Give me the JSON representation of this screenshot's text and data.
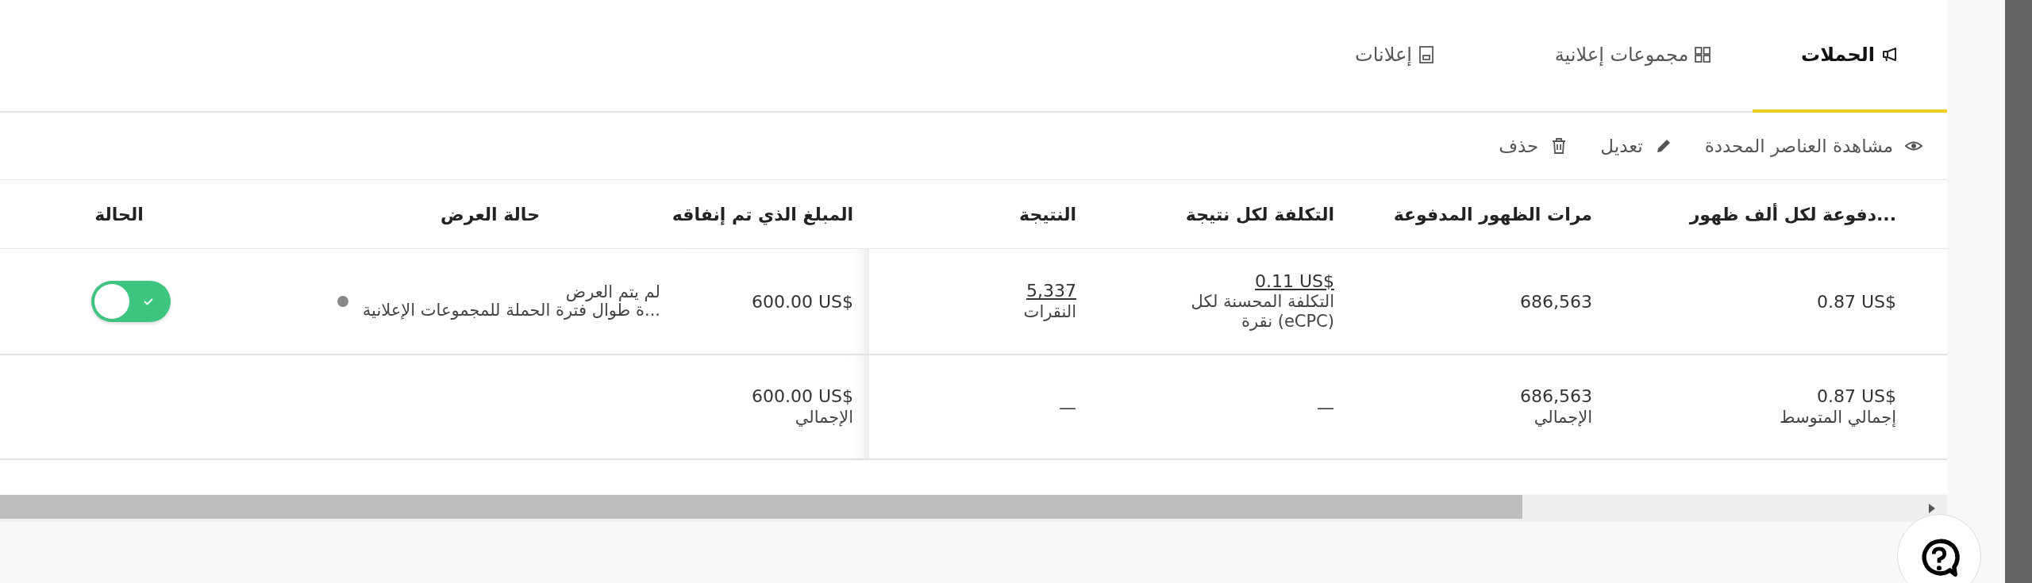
{
  "tabs": [
    {
      "label": "الحملات",
      "selected": true
    },
    {
      "label": "مجموعات إعلانية",
      "selected": false
    },
    {
      "label": "إعلانات",
      "selected": false
    }
  ],
  "actions": [
    "مشاهدة العناصر المحددة",
    "تعديل",
    "حذف"
  ],
  "table": {
    "columns": [
      "...دفوعة لكل ألف ظهور",
      "مرات الظهور المدفوعة",
      "التكلفة لكل نتيجة",
      "النتيجة",
      "المبلغ الذي تم إنفاقه",
      "حالة العرض",
      "الحالة"
    ],
    "rows": [
      {
        "cpm": "0.87 US$",
        "impressions": "686,563",
        "cost_per_result": {
          "value": "0.11 US$",
          "label": "التكلفة المحسنة لكل (eCPC) نقرة"
        },
        "result": {
          "value": "5,337",
          "label": "النقرات"
        },
        "spent": "600.00 US$",
        "delivery": {
          "status": "لم يتم العرض",
          "detail": "...ة طوال فترة الحملة للمجموعات الإعلانية"
        },
        "on": true
      }
    ],
    "totals": {
      "cpm": {
        "value": "0.87 US$",
        "label": "إجمالي المتوسط"
      },
      "impressions": {
        "value": "686,563",
        "label": "الإجمالي"
      },
      "cost_per_result": "—",
      "result": "—",
      "spent": {
        "value": "600.00 US$",
        "label": "الإجمالي"
      }
    }
  }
}
